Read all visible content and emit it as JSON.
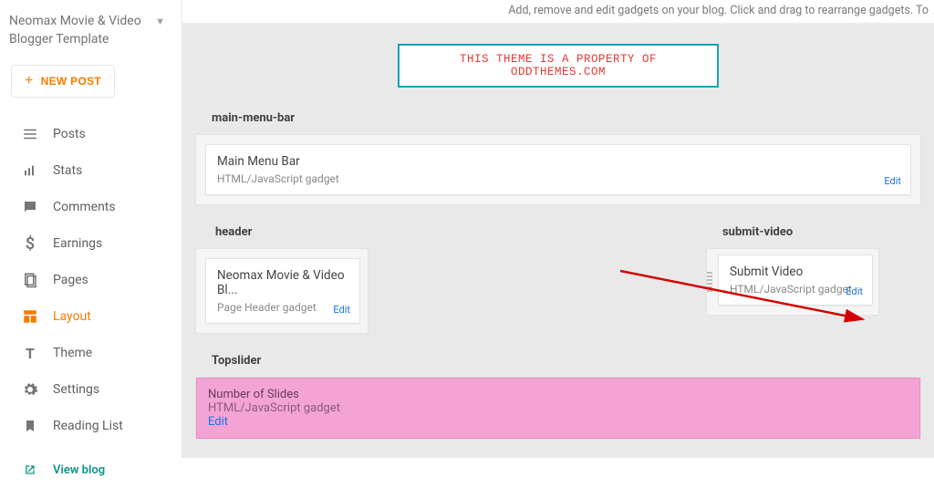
{
  "sidebar": {
    "site_title": "Neomax Movie & Video Blogger Template",
    "new_post": "NEW POST",
    "items": [
      {
        "label": "Posts"
      },
      {
        "label": "Stats"
      },
      {
        "label": "Comments"
      },
      {
        "label": "Earnings"
      },
      {
        "label": "Pages"
      },
      {
        "label": "Layout"
      },
      {
        "label": "Theme"
      },
      {
        "label": "Settings"
      },
      {
        "label": "Reading List"
      }
    ],
    "view_blog": "View blog"
  },
  "main": {
    "top_hint": "Add, remove and edit gadgets on your blog. Click and drag to rearrange gadgets. To",
    "banner": "THIS THEME IS A PROPERTY OF ODDTHEMES.COM",
    "edit_label": "Edit",
    "sections": {
      "mainmenu": {
        "label": "main-menu-bar",
        "title": "Main Menu Bar",
        "sub": "HTML/JavaScript gadget"
      },
      "header": {
        "label": "header",
        "title": "Neomax Movie & Video Bl...",
        "sub": "Page Header gadget"
      },
      "submit": {
        "label": "submit-video",
        "title": "Submit Video",
        "sub": "HTML/JavaScript gadget"
      },
      "topslider": {
        "label": "Topslider",
        "title": "Number of Slides",
        "sub": "HTML/JavaScript gadget"
      }
    }
  }
}
